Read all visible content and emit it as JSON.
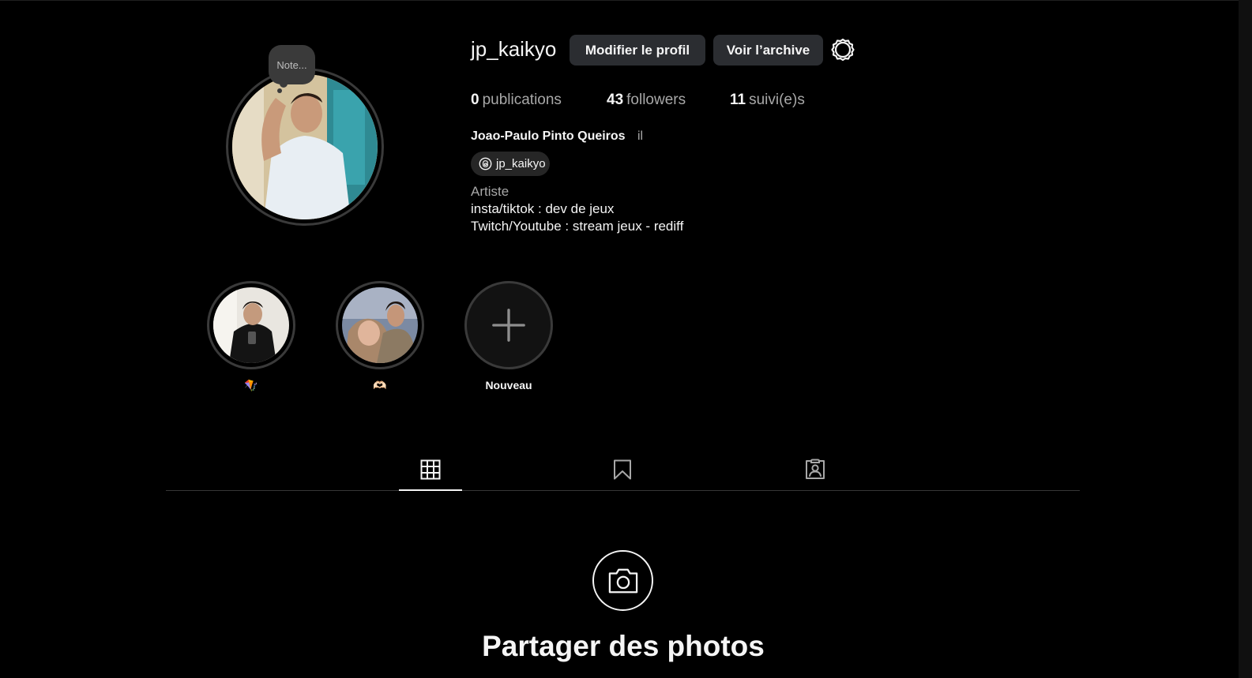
{
  "profile": {
    "username": "jp_kaikyo",
    "full_name": "Joao-Paulo Pinto Queiros",
    "pronoun": "il",
    "note": "Note...",
    "threads_handle": "jp_kaikyo",
    "category": "Artiste",
    "bio_lines": [
      "insta/tiktok : dev de jeux",
      "Twitch/Youtube : stream jeux - rediff"
    ]
  },
  "actions": {
    "edit_profile": "Modifier le profil",
    "view_archive": "Voir l’archive",
    "settings_icon": "gear-icon"
  },
  "stats": {
    "posts": {
      "value": "0",
      "label": "publications"
    },
    "followers": {
      "value": "43",
      "label": "followers"
    },
    "following": {
      "value": "11",
      "label": "suivi(e)s"
    }
  },
  "highlights": [
    {
      "label": "🪁"
    },
    {
      "label": "🫶🏻"
    },
    {
      "label": "Nouveau"
    }
  ],
  "tabs": [
    {
      "icon": "grid-icon",
      "active": true
    },
    {
      "icon": "bookmark-icon",
      "active": false
    },
    {
      "icon": "tagged-user-icon",
      "active": false
    }
  ],
  "empty_state": {
    "icon": "camera-icon",
    "title": "Partager des photos"
  },
  "colors": {
    "background": "#000000",
    "button": "#2b2d31",
    "text": "#f5f5f5",
    "muted": "#a8a8a8",
    "ring": "#3a3a3a"
  }
}
